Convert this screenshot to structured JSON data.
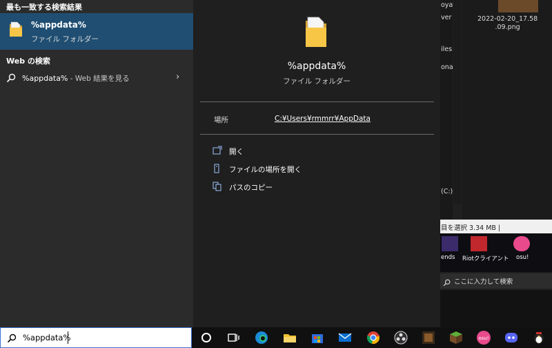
{
  "search_results": {
    "best_match_header": "最も一致する検索結果",
    "best_match": {
      "name": "%appdata%",
      "type": "ファイル フォルダー"
    },
    "web_header": "Web の検索",
    "web_item": {
      "query": "%appdata%",
      "suffix": " - Web 結果を見る"
    }
  },
  "detail": {
    "name": "%appdata%",
    "type": "ファイル フォルダー",
    "location_label": "場所",
    "location_value": "C:¥Users¥rmmrr¥AppData",
    "actions": [
      {
        "icon": "open-icon",
        "label": "開く"
      },
      {
        "icon": "open-file-location-icon",
        "label": "ファイルの場所を開く"
      },
      {
        "icon": "copy-path-icon",
        "label": "パスのコピー"
      }
    ]
  },
  "background": {
    "edge_texts": [
      "oyav",
      "ver",
      "iles",
      "onal",
      "(C:)"
    ],
    "image_caption": "2022-02-20_17.58\n.09.png",
    "status_text": "目を選択  3.34 MB  |",
    "desktop_icons": [
      "ends",
      "Riotクライアント",
      "osu!"
    ],
    "taskbar_search_placeholder": "ここに入力して検索"
  },
  "taskbar": {
    "search_value": "%appdata%",
    "apps": [
      "cortana-icon",
      "task-view-icon",
      "edge-icon",
      "file-explorer-icon",
      "microsoft-store-icon",
      "mail-icon",
      "chrome-icon",
      "obs-icon",
      "minecraft-dungeons-icon",
      "minecraft-icon",
      "osu-icon",
      "discord-icon",
      "penguin-app-icon"
    ]
  },
  "colors": {
    "selection": "#1f4e72",
    "accent": "#3a6fd0"
  }
}
